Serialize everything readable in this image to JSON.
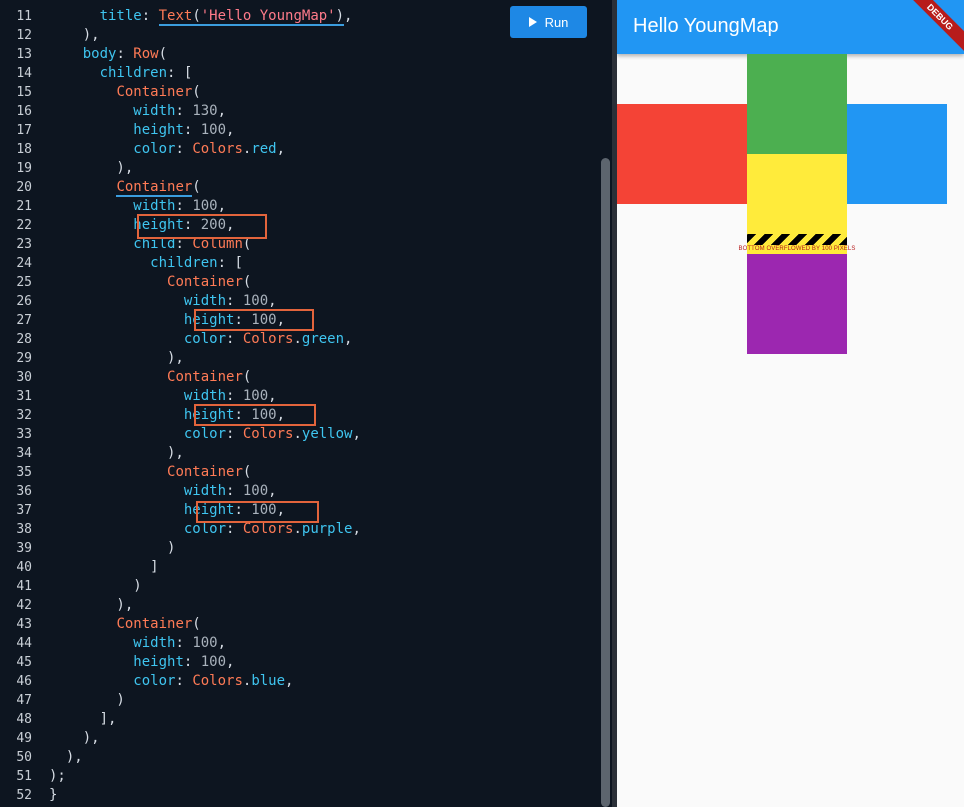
{
  "editor": {
    "run_label": "Run",
    "lines": [
      {
        "n": "11",
        "segs": [
          [
            "      ",
            "p"
          ],
          [
            "title",
            "prop"
          ],
          [
            ": ",
            "p"
          ],
          [
            "Text",
            "cls-u"
          ],
          [
            "(",
            "p-u"
          ],
          [
            "'Hello YoungMap'",
            "str-u"
          ],
          [
            ")",
            "p-u"
          ],
          [
            ",",
            "p"
          ]
        ]
      },
      {
        "n": "12",
        "segs": [
          [
            "    ),",
            "p"
          ]
        ]
      },
      {
        "n": "13",
        "segs": [
          [
            "    ",
            "p"
          ],
          [
            "body",
            "prop"
          ],
          [
            ": ",
            "p"
          ],
          [
            "Row",
            "cls"
          ],
          [
            "(",
            "p"
          ]
        ]
      },
      {
        "n": "14",
        "segs": [
          [
            "      ",
            "p"
          ],
          [
            "children",
            "prop"
          ],
          [
            ": [",
            "p"
          ]
        ]
      },
      {
        "n": "15",
        "segs": [
          [
            "        ",
            "p"
          ],
          [
            "Container",
            "cls"
          ],
          [
            "(",
            "p"
          ]
        ]
      },
      {
        "n": "16",
        "segs": [
          [
            "          ",
            "p"
          ],
          [
            "width",
            "prop"
          ],
          [
            ": ",
            "p"
          ],
          [
            "130",
            "num"
          ],
          [
            ",",
            "p"
          ]
        ]
      },
      {
        "n": "17",
        "segs": [
          [
            "          ",
            "p"
          ],
          [
            "height",
            "prop"
          ],
          [
            ": ",
            "p"
          ],
          [
            "100",
            "num"
          ],
          [
            ",",
            "p"
          ]
        ]
      },
      {
        "n": "18",
        "segs": [
          [
            "          ",
            "p"
          ],
          [
            "color",
            "prop"
          ],
          [
            ": ",
            "p"
          ],
          [
            "Colors",
            "cls"
          ],
          [
            ".",
            "p"
          ],
          [
            "red",
            "prop"
          ],
          [
            ",",
            "p"
          ]
        ]
      },
      {
        "n": "19",
        "segs": [
          [
            "        ),",
            "p"
          ]
        ]
      },
      {
        "n": "20",
        "segs": [
          [
            "        ",
            "p"
          ],
          [
            "Container",
            "cls-u"
          ],
          [
            "(",
            "p"
          ]
        ]
      },
      {
        "n": "21",
        "segs": [
          [
            "          ",
            "p"
          ],
          [
            "width",
            "prop"
          ],
          [
            ": ",
            "p"
          ],
          [
            "100",
            "num"
          ],
          [
            ",",
            "p"
          ]
        ]
      },
      {
        "n": "22",
        "segs": [
          [
            "          ",
            "p"
          ],
          [
            "height",
            "prop"
          ],
          [
            ": ",
            "p"
          ],
          [
            "200",
            "num"
          ],
          [
            ",",
            "p"
          ]
        ]
      },
      {
        "n": "23",
        "segs": [
          [
            "          ",
            "p"
          ],
          [
            "child",
            "prop"
          ],
          [
            ": ",
            "p"
          ],
          [
            "Column",
            "cls"
          ],
          [
            "(",
            "p"
          ]
        ]
      },
      {
        "n": "24",
        "segs": [
          [
            "            ",
            "p"
          ],
          [
            "children",
            "prop"
          ],
          [
            ": [",
            "p"
          ]
        ]
      },
      {
        "n": "25",
        "segs": [
          [
            "              ",
            "p"
          ],
          [
            "Container",
            "cls"
          ],
          [
            "(",
            "p"
          ]
        ]
      },
      {
        "n": "26",
        "segs": [
          [
            "                ",
            "p"
          ],
          [
            "width",
            "prop"
          ],
          [
            ": ",
            "p"
          ],
          [
            "100",
            "num"
          ],
          [
            ",",
            "p"
          ]
        ]
      },
      {
        "n": "27",
        "segs": [
          [
            "                ",
            "p"
          ],
          [
            "height",
            "prop"
          ],
          [
            ": ",
            "p"
          ],
          [
            "100",
            "num"
          ],
          [
            ",",
            "p"
          ]
        ]
      },
      {
        "n": "28",
        "segs": [
          [
            "                ",
            "p"
          ],
          [
            "color",
            "prop"
          ],
          [
            ": ",
            "p"
          ],
          [
            "Colors",
            "cls"
          ],
          [
            ".",
            "p"
          ],
          [
            "green",
            "prop"
          ],
          [
            ",",
            "p"
          ]
        ]
      },
      {
        "n": "29",
        "segs": [
          [
            "              ),",
            "p"
          ]
        ]
      },
      {
        "n": "30",
        "segs": [
          [
            "              ",
            "p"
          ],
          [
            "Container",
            "cls"
          ],
          [
            "(",
            "p"
          ]
        ]
      },
      {
        "n": "31",
        "segs": [
          [
            "                ",
            "p"
          ],
          [
            "width",
            "prop"
          ],
          [
            ": ",
            "p"
          ],
          [
            "100",
            "num"
          ],
          [
            ",",
            "p"
          ]
        ]
      },
      {
        "n": "32",
        "segs": [
          [
            "                ",
            "p"
          ],
          [
            "height",
            "prop"
          ],
          [
            ": ",
            "p"
          ],
          [
            "100",
            "num"
          ],
          [
            ",",
            "p"
          ]
        ]
      },
      {
        "n": "33",
        "segs": [
          [
            "                ",
            "p"
          ],
          [
            "color",
            "prop"
          ],
          [
            ": ",
            "p"
          ],
          [
            "Colors",
            "cls"
          ],
          [
            ".",
            "p"
          ],
          [
            "yellow",
            "prop"
          ],
          [
            ",",
            "p"
          ]
        ]
      },
      {
        "n": "34",
        "segs": [
          [
            "              ),",
            "p"
          ]
        ]
      },
      {
        "n": "35",
        "segs": [
          [
            "              ",
            "p"
          ],
          [
            "Container",
            "cls"
          ],
          [
            "(",
            "p"
          ]
        ]
      },
      {
        "n": "36",
        "segs": [
          [
            "                ",
            "p"
          ],
          [
            "width",
            "prop"
          ],
          [
            ": ",
            "p"
          ],
          [
            "100",
            "num"
          ],
          [
            ",",
            "p"
          ]
        ]
      },
      {
        "n": "37",
        "segs": [
          [
            "                ",
            "p"
          ],
          [
            "height",
            "prop"
          ],
          [
            ": ",
            "p"
          ],
          [
            "100",
            "num"
          ],
          [
            ",",
            "p"
          ]
        ]
      },
      {
        "n": "38",
        "segs": [
          [
            "                ",
            "p"
          ],
          [
            "color",
            "prop"
          ],
          [
            ": ",
            "p"
          ],
          [
            "Colors",
            "cls"
          ],
          [
            ".",
            "p"
          ],
          [
            "purple",
            "prop"
          ],
          [
            ",",
            "p"
          ]
        ]
      },
      {
        "n": "39",
        "segs": [
          [
            "              )",
            "p"
          ]
        ]
      },
      {
        "n": "40",
        "segs": [
          [
            "            ]",
            "p"
          ]
        ]
      },
      {
        "n": "41",
        "segs": [
          [
            "          )",
            "p"
          ]
        ]
      },
      {
        "n": "42",
        "segs": [
          [
            "        ),",
            "p"
          ]
        ]
      },
      {
        "n": "43",
        "segs": [
          [
            "        ",
            "p"
          ],
          [
            "Container",
            "cls"
          ],
          [
            "(",
            "p"
          ]
        ]
      },
      {
        "n": "44",
        "segs": [
          [
            "          ",
            "p"
          ],
          [
            "width",
            "prop"
          ],
          [
            ": ",
            "p"
          ],
          [
            "100",
            "num"
          ],
          [
            ",",
            "p"
          ]
        ]
      },
      {
        "n": "45",
        "segs": [
          [
            "          ",
            "p"
          ],
          [
            "height",
            "prop"
          ],
          [
            ": ",
            "p"
          ],
          [
            "100",
            "num"
          ],
          [
            ",",
            "p"
          ]
        ]
      },
      {
        "n": "46",
        "segs": [
          [
            "          ",
            "p"
          ],
          [
            "color",
            "prop"
          ],
          [
            ": ",
            "p"
          ],
          [
            "Colors",
            "cls"
          ],
          [
            ".",
            "p"
          ],
          [
            "blue",
            "prop"
          ],
          [
            ",",
            "p"
          ]
        ]
      },
      {
        "n": "47",
        "segs": [
          [
            "        )",
            "p"
          ]
        ]
      },
      {
        "n": "48",
        "segs": [
          [
            "      ],",
            "p"
          ]
        ]
      },
      {
        "n": "49",
        "segs": [
          [
            "    ),",
            "p"
          ]
        ]
      },
      {
        "n": "50",
        "segs": [
          [
            "  ),",
            "p"
          ]
        ]
      },
      {
        "n": "51",
        "segs": [
          [
            ");",
            "p"
          ]
        ]
      },
      {
        "n": "52",
        "segs": [
          [
            "}",
            "p"
          ]
        ]
      }
    ]
  },
  "preview": {
    "app_title": "Hello YoungMap",
    "debug_label": "DEBUG",
    "overflow_message": "BOTTOM OVERFLOWED BY 100 PIXELS",
    "colors": {
      "red": "#f44336",
      "green": "#4caf50",
      "yellow": "#ffeb3b",
      "purple": "#9c27b0",
      "blue": "#2196f3"
    }
  }
}
